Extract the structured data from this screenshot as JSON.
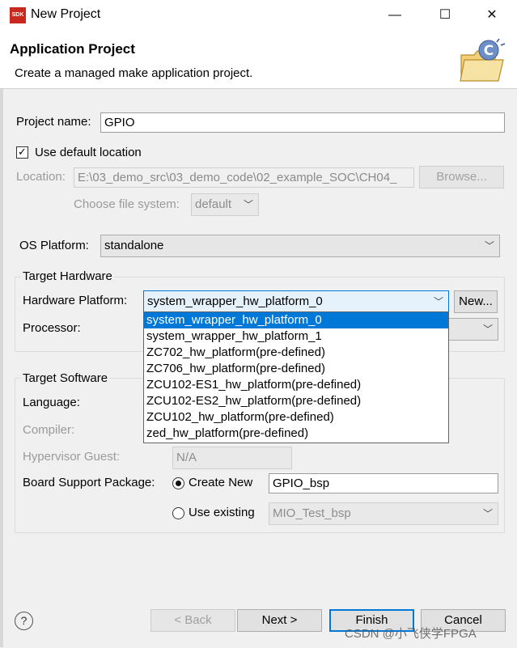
{
  "window": {
    "app_icon_text": "SDK",
    "title": "New Project",
    "minimize": "—",
    "maximize": "☐",
    "close": "✕"
  },
  "header": {
    "title": "Application Project",
    "description": "Create a managed make application project."
  },
  "project": {
    "name_label": "Project name:",
    "name_value": "GPIO",
    "use_default_location_label": "Use default location",
    "use_default_location_checked": true,
    "location_label": "Location:",
    "location_value": "E:\\03_demo_src\\03_demo_code\\02_example_SOC\\CH04_",
    "browse_label": "Browse...",
    "file_system_label": "Choose file system:",
    "file_system_value": "default"
  },
  "os": {
    "label": "OS Platform:",
    "value": "standalone"
  },
  "target_hardware": {
    "group_label": "Target Hardware",
    "platform_label": "Hardware Platform:",
    "platform_value": "system_wrapper_hw_platform_0",
    "new_button": "New...",
    "processor_label": "Processor:",
    "dropdown_options": [
      "system_wrapper_hw_platform_0",
      "system_wrapper_hw_platform_1",
      "ZC702_hw_platform(pre-defined)",
      "ZC706_hw_platform(pre-defined)",
      "ZCU102-ES1_hw_platform(pre-defined)",
      "ZCU102-ES2_hw_platform(pre-defined)",
      "ZCU102_hw_platform(pre-defined)",
      "zed_hw_platform(pre-defined)"
    ],
    "selected_index": 0
  },
  "target_software": {
    "group_label": "Target Software",
    "language_label": "Language:",
    "compiler_label": "Compiler:",
    "hypervisor_label": "Hypervisor Guest:",
    "hypervisor_value": "N/A",
    "bsp_label": "Board Support Package:",
    "create_new_label": "Create New",
    "create_new_value": "GPIO_bsp",
    "use_existing_label": "Use existing",
    "use_existing_value": "MIO_Test_bsp"
  },
  "footer": {
    "help": "?",
    "back": "< Back",
    "next": "Next >",
    "finish": "Finish",
    "cancel": "Cancel"
  },
  "watermark": "CSDN @小飞侠学FPGA",
  "colors": {
    "selection": "#0078d7",
    "sdk_icon": "#c8281e"
  }
}
